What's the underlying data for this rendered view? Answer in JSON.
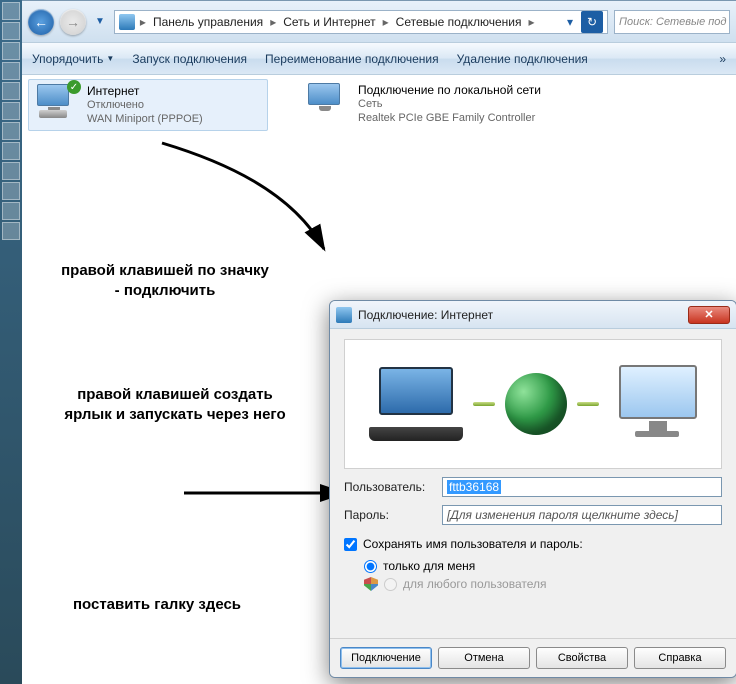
{
  "breadcrumb": {
    "parts": [
      "Панель управления",
      "Сеть и Интернет",
      "Сетевые подключения"
    ]
  },
  "search": {
    "placeholder": "Поиск: Сетевые под"
  },
  "toolbar": {
    "organize": "Упорядочить",
    "start": "Запуск подключения",
    "rename": "Переименование подключения",
    "delete": "Удаление подключения",
    "more": "»"
  },
  "conn1": {
    "name": "Интернет",
    "status": "Отключено",
    "device": "WAN Miniport (PPPOE)"
  },
  "conn2": {
    "name": "Подключение по локальной сети",
    "status": "Сеть",
    "device": "Realtek PCIe GBE Family Controller"
  },
  "annot": {
    "a1": "правой клавишей по значку - подключить",
    "a2": "правой клавишей создать ярлык и запускать через него",
    "a3": "поставить галку здесь"
  },
  "dialog": {
    "title": "Подключение: Интернет",
    "user_label": "Пользователь:",
    "user_value": "fttb36168",
    "pass_label": "Пароль:",
    "pass_value": "[Для изменения пароля щелкните здесь]",
    "save_label": "Сохранять имя пользователя и пароль:",
    "only_me": "только для меня",
    "any_user": "для любого пользователя",
    "btn_connect": "Подключение",
    "btn_cancel": "Отмена",
    "btn_props": "Свойства",
    "btn_help": "Справка"
  }
}
